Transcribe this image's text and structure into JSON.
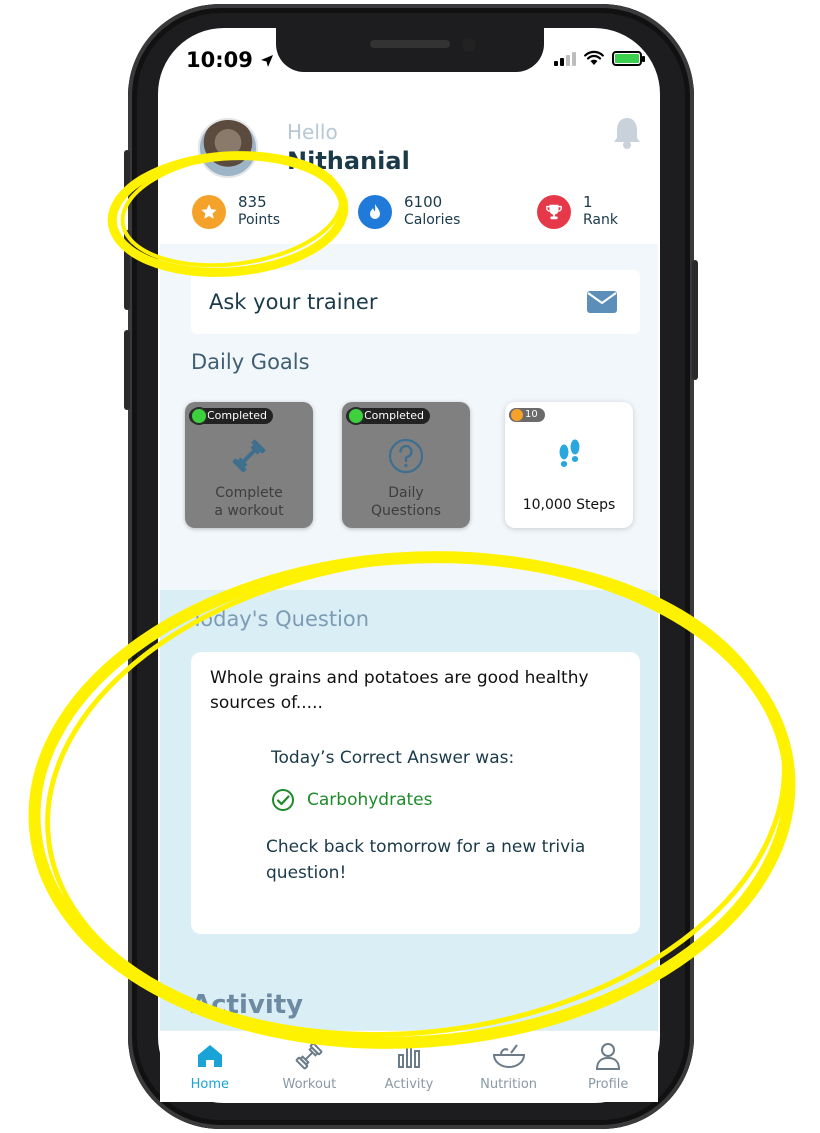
{
  "status": {
    "time": "10:09"
  },
  "header": {
    "greeting": "Hello",
    "user_name": "Nithanial"
  },
  "stats": [
    {
      "value": "835",
      "label": "Points",
      "color": "#f4a22a",
      "icon": "star-icon"
    },
    {
      "value": "6100",
      "label": "Calories",
      "color": "#1f7ad9",
      "icon": "flame-icon"
    },
    {
      "value": "1",
      "label": "Rank",
      "color": "#e5394a",
      "icon": "trophy-icon"
    }
  ],
  "trainer": {
    "label": "Ask your trainer",
    "icon": "mail-icon"
  },
  "daily_goals": {
    "title": "Daily Goals",
    "items": [
      {
        "badge": "Completed",
        "label_line1": "Complete",
        "label_line2": "a workout",
        "icon": "dumbbell-icon",
        "status": "completed"
      },
      {
        "badge": "Completed",
        "label_line1": "Daily",
        "label_line2": "Questions",
        "icon": "question-circle-icon",
        "status": "completed"
      },
      {
        "points": "10",
        "label": "10,000 Steps",
        "icon": "footsteps-icon",
        "status": "pending"
      }
    ]
  },
  "question": {
    "title": "Today's Question",
    "text": "Whole grains and potatoes are good healthy sources of.....",
    "answer_label": "Today’s Correct Answer was:",
    "answer": "Carbohydrates",
    "footer": "Check back tomorrow for a new trivia question!"
  },
  "activity": {
    "title": "Activity"
  },
  "tabbar": {
    "items": [
      {
        "label": "Home",
        "active": true
      },
      {
        "label": "Workout",
        "active": false
      },
      {
        "label": "Activity",
        "active": false
      },
      {
        "label": "Nutrition",
        "active": false
      },
      {
        "label": "Profile",
        "active": false
      }
    ]
  },
  "colors": {
    "accent": "#1aa3d6",
    "annotation": "#fff200",
    "completed_gray": "#808080",
    "answer_green": "#1f8a2a"
  }
}
